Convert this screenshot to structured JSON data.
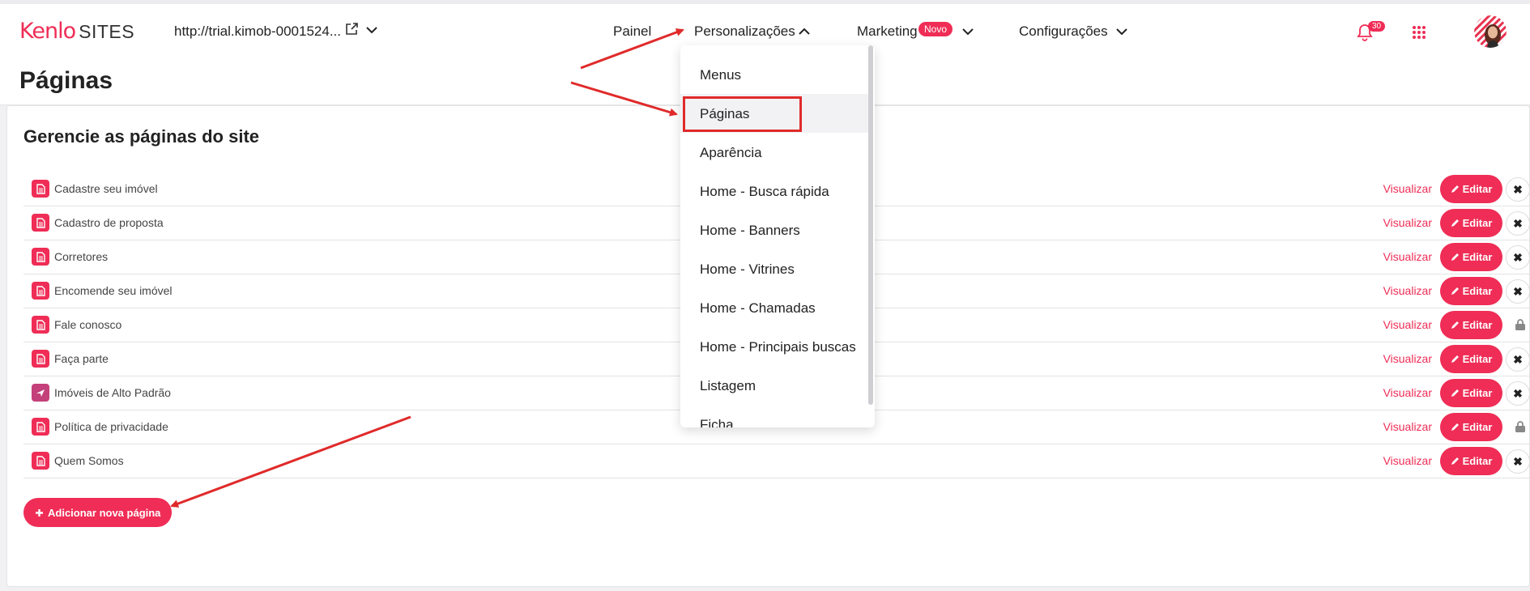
{
  "header": {
    "logo_kenlo": "Kenlo",
    "logo_sites": "SITES",
    "site_url": "http://trial.kimob-0001524...",
    "nav": {
      "painel": "Painel",
      "personalizacoes": "Personalizações",
      "marketing": "Marketing",
      "marketing_badge": "Novo",
      "configuracoes": "Configurações"
    },
    "notifications_count": "30"
  },
  "page_title": "Páginas",
  "card_title": "Gerencie as páginas do site",
  "view_label": "Visualizar",
  "edit_label": "Editar",
  "add_label": "Adicionar nova página",
  "pages": [
    {
      "label": "Cadastre seu imóvel",
      "deletable": true
    },
    {
      "label": "Cadastro de proposta",
      "deletable": true
    },
    {
      "label": "Corretores",
      "deletable": true
    },
    {
      "label": "Encomende seu imóvel",
      "deletable": true
    },
    {
      "label": "Fale conosco",
      "deletable": false
    },
    {
      "label": "Faça parte",
      "deletable": true
    },
    {
      "label": "Imóveis de Alto Padrão",
      "deletable": true
    },
    {
      "label": "Política de privacidade",
      "deletable": false
    },
    {
      "label": "Quem Somos",
      "deletable": true
    }
  ],
  "dropdown": {
    "items": [
      "Menus",
      "Páginas",
      "Aparência",
      "Home - Busca rápida",
      "Home - Banners",
      "Home - Vitrines",
      "Home - Chamadas",
      "Home - Principais buscas",
      "Listagem",
      "Ficha"
    ]
  },
  "colors": {
    "accent": "#ef2d56",
    "annotation": "#e02a2a"
  }
}
